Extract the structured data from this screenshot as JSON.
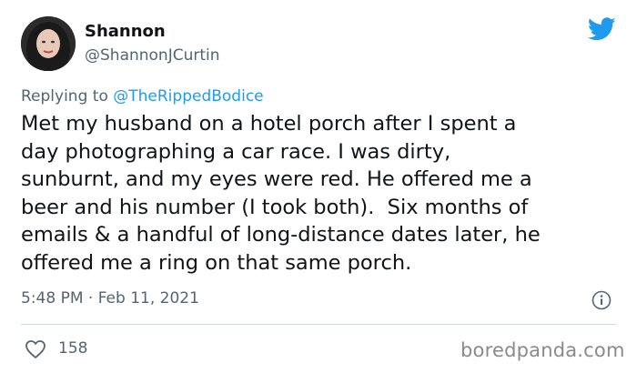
{
  "author": {
    "name": "Shannon",
    "handle": "@ShannonJCurtin"
  },
  "reply": {
    "prefix": "Replying to ",
    "mention": "@TheRippedBodice"
  },
  "tweet": {
    "text": "Met my husband on a hotel porch after I spent a\nday photographing a car race. I was dirty,\nsunburnt, and my eyes were red. He offered me a\nbeer and his number (I took both).  Six months of\nemails & a handful of long-distance dates later, he\noffered me a ring on that same porch.",
    "timestamp": "5:48 PM · Feb 11, 2021"
  },
  "stats": {
    "likes": "158"
  },
  "watermark": "boredpanda.com",
  "icons": {
    "logo": "twitter-bird-icon",
    "info": "info-icon",
    "like": "heart-icon"
  },
  "colors": {
    "accent": "#1d9bf0",
    "secondary_text": "#536471",
    "primary_text": "#0f1419",
    "divider": "#cfd9de"
  }
}
